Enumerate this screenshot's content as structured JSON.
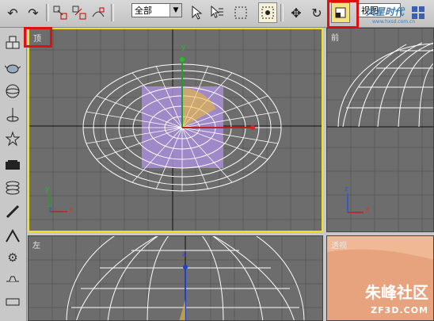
{
  "toolbar": {
    "selection_filter": "全部",
    "viewport_dropdown": "视图"
  },
  "viewports": {
    "top": {
      "label": "顶"
    },
    "front": {
      "label": "前"
    },
    "left": {
      "label": "左"
    },
    "perspective": {
      "label": "透视"
    }
  },
  "axes": {
    "x": "x",
    "y": "y",
    "z": "z"
  },
  "watermark": {
    "top_text": "火星时代",
    "top_sub": "www.hxsd.com.cn",
    "brand": "朱峰社区",
    "url": "ZF3D.COM"
  },
  "colors": {
    "highlight": "#e01010",
    "viewport_bg": "#6d6d6d",
    "active_border": "#f0e020",
    "wire": "#ffffff",
    "selection_fill": "#a98ed8"
  }
}
